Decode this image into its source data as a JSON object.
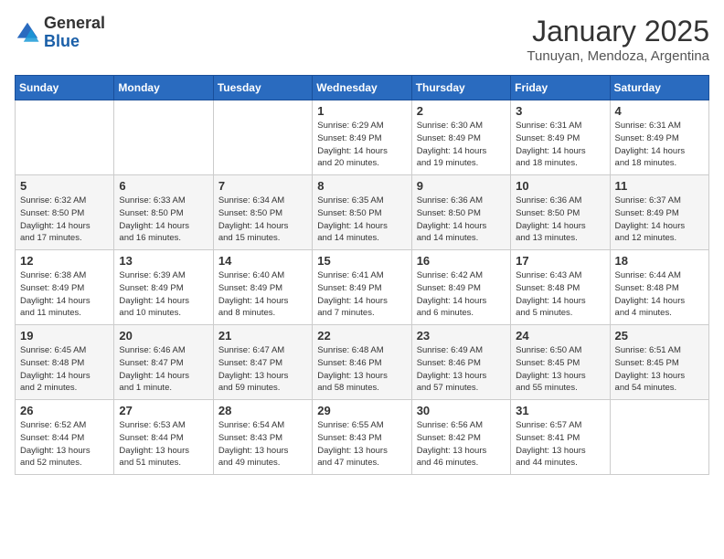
{
  "header": {
    "logo_general": "General",
    "logo_blue": "Blue",
    "month_title": "January 2025",
    "subtitle": "Tunuyan, Mendoza, Argentina"
  },
  "days_of_week": [
    "Sunday",
    "Monday",
    "Tuesday",
    "Wednesday",
    "Thursday",
    "Friday",
    "Saturday"
  ],
  "weeks": [
    [
      {
        "day": "",
        "info": ""
      },
      {
        "day": "",
        "info": ""
      },
      {
        "day": "",
        "info": ""
      },
      {
        "day": "1",
        "info": "Sunrise: 6:29 AM\nSunset: 8:49 PM\nDaylight: 14 hours\nand 20 minutes."
      },
      {
        "day": "2",
        "info": "Sunrise: 6:30 AM\nSunset: 8:49 PM\nDaylight: 14 hours\nand 19 minutes."
      },
      {
        "day": "3",
        "info": "Sunrise: 6:31 AM\nSunset: 8:49 PM\nDaylight: 14 hours\nand 18 minutes."
      },
      {
        "day": "4",
        "info": "Sunrise: 6:31 AM\nSunset: 8:49 PM\nDaylight: 14 hours\nand 18 minutes."
      }
    ],
    [
      {
        "day": "5",
        "info": "Sunrise: 6:32 AM\nSunset: 8:50 PM\nDaylight: 14 hours\nand 17 minutes."
      },
      {
        "day": "6",
        "info": "Sunrise: 6:33 AM\nSunset: 8:50 PM\nDaylight: 14 hours\nand 16 minutes."
      },
      {
        "day": "7",
        "info": "Sunrise: 6:34 AM\nSunset: 8:50 PM\nDaylight: 14 hours\nand 15 minutes."
      },
      {
        "day": "8",
        "info": "Sunrise: 6:35 AM\nSunset: 8:50 PM\nDaylight: 14 hours\nand 14 minutes."
      },
      {
        "day": "9",
        "info": "Sunrise: 6:36 AM\nSunset: 8:50 PM\nDaylight: 14 hours\nand 14 minutes."
      },
      {
        "day": "10",
        "info": "Sunrise: 6:36 AM\nSunset: 8:50 PM\nDaylight: 14 hours\nand 13 minutes."
      },
      {
        "day": "11",
        "info": "Sunrise: 6:37 AM\nSunset: 8:49 PM\nDaylight: 14 hours\nand 12 minutes."
      }
    ],
    [
      {
        "day": "12",
        "info": "Sunrise: 6:38 AM\nSunset: 8:49 PM\nDaylight: 14 hours\nand 11 minutes."
      },
      {
        "day": "13",
        "info": "Sunrise: 6:39 AM\nSunset: 8:49 PM\nDaylight: 14 hours\nand 10 minutes."
      },
      {
        "day": "14",
        "info": "Sunrise: 6:40 AM\nSunset: 8:49 PM\nDaylight: 14 hours\nand 8 minutes."
      },
      {
        "day": "15",
        "info": "Sunrise: 6:41 AM\nSunset: 8:49 PM\nDaylight: 14 hours\nand 7 minutes."
      },
      {
        "day": "16",
        "info": "Sunrise: 6:42 AM\nSunset: 8:49 PM\nDaylight: 14 hours\nand 6 minutes."
      },
      {
        "day": "17",
        "info": "Sunrise: 6:43 AM\nSunset: 8:48 PM\nDaylight: 14 hours\nand 5 minutes."
      },
      {
        "day": "18",
        "info": "Sunrise: 6:44 AM\nSunset: 8:48 PM\nDaylight: 14 hours\nand 4 minutes."
      }
    ],
    [
      {
        "day": "19",
        "info": "Sunrise: 6:45 AM\nSunset: 8:48 PM\nDaylight: 14 hours\nand 2 minutes."
      },
      {
        "day": "20",
        "info": "Sunrise: 6:46 AM\nSunset: 8:47 PM\nDaylight: 14 hours\nand 1 minute."
      },
      {
        "day": "21",
        "info": "Sunrise: 6:47 AM\nSunset: 8:47 PM\nDaylight: 13 hours\nand 59 minutes."
      },
      {
        "day": "22",
        "info": "Sunrise: 6:48 AM\nSunset: 8:46 PM\nDaylight: 13 hours\nand 58 minutes."
      },
      {
        "day": "23",
        "info": "Sunrise: 6:49 AM\nSunset: 8:46 PM\nDaylight: 13 hours\nand 57 minutes."
      },
      {
        "day": "24",
        "info": "Sunrise: 6:50 AM\nSunset: 8:45 PM\nDaylight: 13 hours\nand 55 minutes."
      },
      {
        "day": "25",
        "info": "Sunrise: 6:51 AM\nSunset: 8:45 PM\nDaylight: 13 hours\nand 54 minutes."
      }
    ],
    [
      {
        "day": "26",
        "info": "Sunrise: 6:52 AM\nSunset: 8:44 PM\nDaylight: 13 hours\nand 52 minutes."
      },
      {
        "day": "27",
        "info": "Sunrise: 6:53 AM\nSunset: 8:44 PM\nDaylight: 13 hours\nand 51 minutes."
      },
      {
        "day": "28",
        "info": "Sunrise: 6:54 AM\nSunset: 8:43 PM\nDaylight: 13 hours\nand 49 minutes."
      },
      {
        "day": "29",
        "info": "Sunrise: 6:55 AM\nSunset: 8:43 PM\nDaylight: 13 hours\nand 47 minutes."
      },
      {
        "day": "30",
        "info": "Sunrise: 6:56 AM\nSunset: 8:42 PM\nDaylight: 13 hours\nand 46 minutes."
      },
      {
        "day": "31",
        "info": "Sunrise: 6:57 AM\nSunset: 8:41 PM\nDaylight: 13 hours\nand 44 minutes."
      },
      {
        "day": "",
        "info": ""
      }
    ]
  ]
}
